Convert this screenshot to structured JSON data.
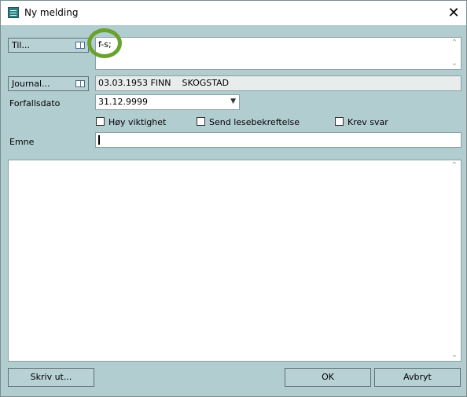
{
  "window": {
    "title": "Ny melding",
    "close_glyph": "✕"
  },
  "fields": {
    "to": {
      "button_label": "Til...",
      "value": "f-s;"
    },
    "journal": {
      "button_label": "Journal...",
      "value": "03.03.1953 FINN    SKOGSTAD"
    },
    "due_date": {
      "label": "Forfallsdato",
      "value": "31.12.9999"
    },
    "subject": {
      "label": "Emne",
      "value": ""
    },
    "body": {
      "value": ""
    }
  },
  "options": {
    "high_importance": {
      "label": "Høy viktighet",
      "checked": false
    },
    "read_receipt": {
      "label": "Send lesebekreftelse",
      "checked": false
    },
    "require_reply": {
      "label": "Krev svar",
      "checked": false
    }
  },
  "buttons": {
    "print": "Skriv ut...",
    "ok": "OK",
    "cancel": "Avbryt"
  },
  "colors": {
    "dialog_bg": "#b2cdd0",
    "annotation_ring": "#6aa12f"
  }
}
